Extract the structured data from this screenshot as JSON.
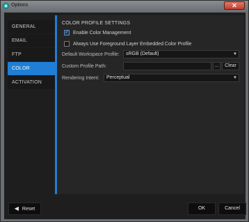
{
  "window": {
    "title": "Options",
    "close_label": "✕"
  },
  "sidebar": {
    "items": [
      {
        "label": "GENERAL"
      },
      {
        "label": "EMAIL"
      },
      {
        "label": "FTP"
      },
      {
        "label": "COLOR"
      },
      {
        "label": "ACTIVATION"
      }
    ],
    "active_index": 3
  },
  "panel": {
    "section_title": "COLOR PROFILE SETTINGS",
    "enable_color_management": {
      "label": "Enable Color Management",
      "checked": true
    },
    "always_use_embedded": {
      "label": "Always Use Foreground Layer Embedded Color Profile",
      "checked": false
    },
    "workspace_profile": {
      "label": "Default Workspace Profile:",
      "value": "sRGB (Default)"
    },
    "custom_profile": {
      "label": "Custom Profile Path:",
      "value": "",
      "browse_label": "...",
      "clear_label": "Clear"
    },
    "rendering_intent": {
      "label": "Rendering Intent:",
      "value": "Perceptual"
    }
  },
  "footer": {
    "reset_label": "Reset",
    "ok_label": "OK",
    "cancel_label": "Cancel"
  },
  "colors": {
    "accent": "#1e7fd4",
    "background": "#1e1e1e",
    "panel": "#262626"
  }
}
